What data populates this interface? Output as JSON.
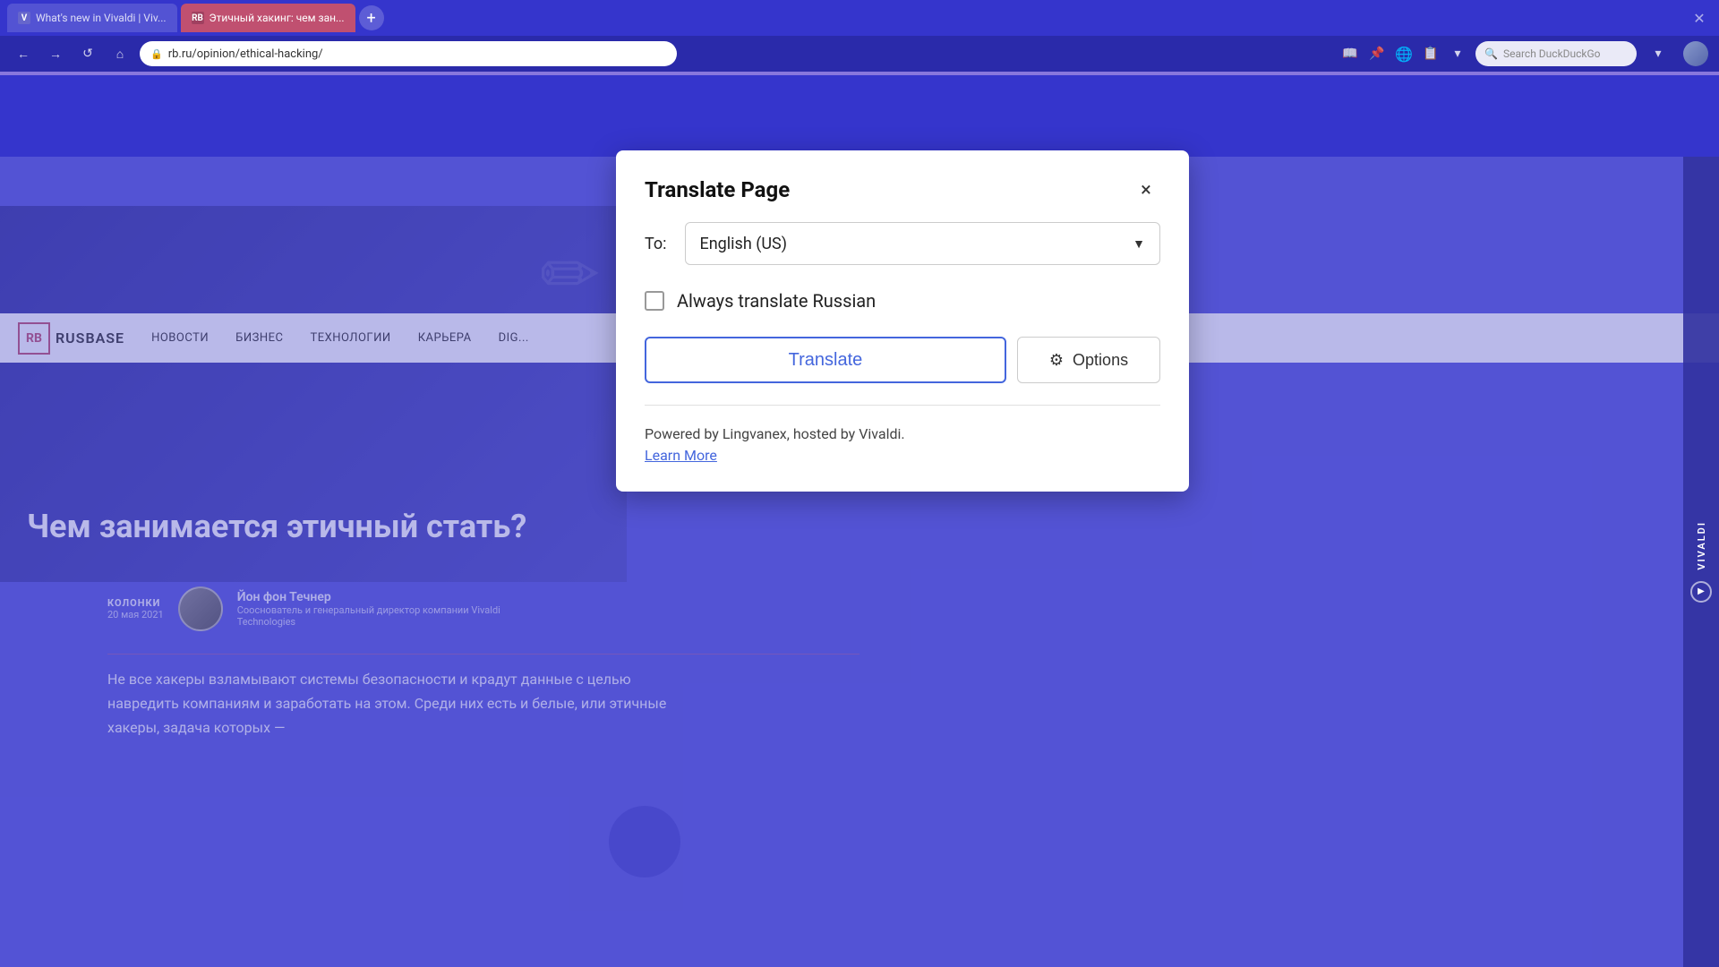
{
  "browser": {
    "tab_inactive_label": "What's new in Vivaldi | Viv...",
    "tab_active_label": "Этичный хакинг: чем зан...",
    "tab_favicon_text": "RB",
    "tab_new_button": "+",
    "nav_back": "←",
    "nav_forward": "→",
    "nav_reload": "↺",
    "nav_home": "⌂",
    "url": "rb.ru/opinion/ethical-hacking/",
    "search_placeholder": "Search DuckDuckGo"
  },
  "site": {
    "logo_initials": "RB",
    "logo_name": "RUSBASE",
    "nav_items": [
      "НОВОСТИ",
      "БИЗНЕС",
      "ТЕХНОЛОГИИ",
      "КАРЬЕРА",
      "DIG..."
    ],
    "hero_title": "Чем занимается этичный\nстать?",
    "author_category": "КОЛОНКИ",
    "author_date": "20 мая 2021",
    "author_name": "Йон фон Течнер",
    "author_bio": "Сооснователь и генеральный директор компании Vivaldi Technologies",
    "article_text": "Не все хакеры взламывают системы безопасности и крадут данные с целью навредить компаниям и заработать на этом. Среди них есть и белые, или этичные хакеры, задача которых —"
  },
  "dialog": {
    "title": "Translate Page",
    "close_label": "×",
    "to_label": "To:",
    "language_selected": "English (US)",
    "dropdown_arrow": "▼",
    "checkbox_label": "Always translate Russian",
    "translate_button": "Translate",
    "options_icon": "⚙",
    "options_button": "Options",
    "powered_by_text": "Powered by Lingvanex, hosted by Vivaldi.",
    "learn_more_label": "Learn More"
  },
  "vivaldi": {
    "logo_text": "VIVALDI",
    "icon_symbol": "▶"
  }
}
